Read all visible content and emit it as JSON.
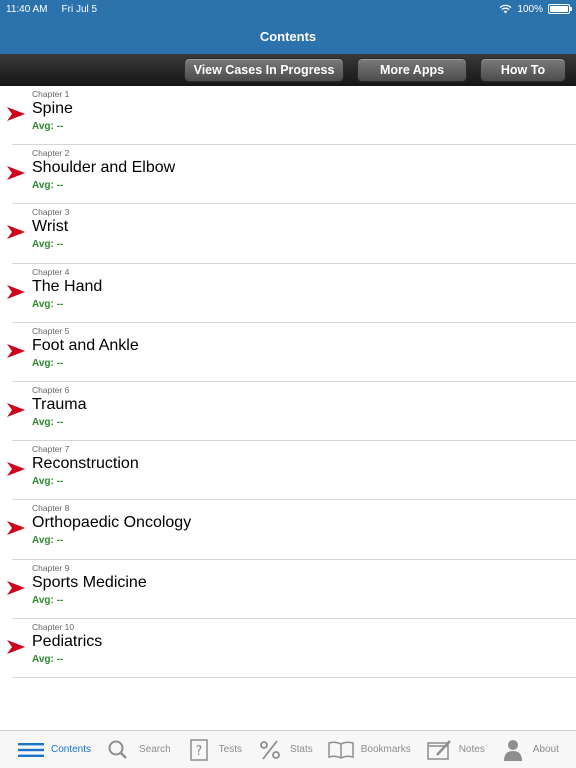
{
  "status": {
    "time": "11:40 AM",
    "date": "Fri Jul 5",
    "battery": "100%",
    "battery_level": 1.0
  },
  "nav": {
    "title": "Contents"
  },
  "toolbar": {
    "view_cases": "View Cases In Progress",
    "more_apps": "More Apps",
    "how_to": "How To"
  },
  "chapters": [
    {
      "num": "Chapter 1",
      "title": "Spine",
      "avg": "Avg: --"
    },
    {
      "num": "Chapter 2",
      "title": "Shoulder and Elbow",
      "avg": "Avg: --"
    },
    {
      "num": "Chapter 3",
      "title": "Wrist",
      "avg": "Avg: --"
    },
    {
      "num": "Chapter 4",
      "title": "The Hand",
      "avg": "Avg: --"
    },
    {
      "num": "Chapter 5",
      "title": "Foot and Ankle",
      "avg": "Avg: --"
    },
    {
      "num": "Chapter 6",
      "title": "Trauma",
      "avg": "Avg: --"
    },
    {
      "num": "Chapter 7",
      "title": "Reconstruction",
      "avg": "Avg: --"
    },
    {
      "num": "Chapter 8",
      "title": "Orthopaedic Oncology",
      "avg": "Avg: --"
    },
    {
      "num": "Chapter 9",
      "title": "Sports Medicine",
      "avg": "Avg: --"
    },
    {
      "num": "Chapter 10",
      "title": "Pediatrics",
      "avg": "Avg: --"
    }
  ],
  "tabs": [
    {
      "label": "Contents",
      "icon": "list-icon",
      "active": true
    },
    {
      "label": "Search",
      "icon": "magnifier-icon",
      "active": false
    },
    {
      "label": "Tests",
      "icon": "question-icon",
      "active": false
    },
    {
      "label": "Stats",
      "icon": "percent-icon",
      "active": false
    },
    {
      "label": "Bookmarks",
      "icon": "book-icon",
      "active": false
    },
    {
      "label": "Notes",
      "icon": "notepad-icon",
      "active": false
    },
    {
      "label": "About",
      "icon": "person-icon",
      "active": false
    }
  ],
  "colors": {
    "nav_blue": "#2c72ad",
    "arrow_red": "#d0021b",
    "avg_green": "#2f8a2f",
    "tab_active": "#1a73c9",
    "tab_inactive": "#8e8e8e"
  }
}
